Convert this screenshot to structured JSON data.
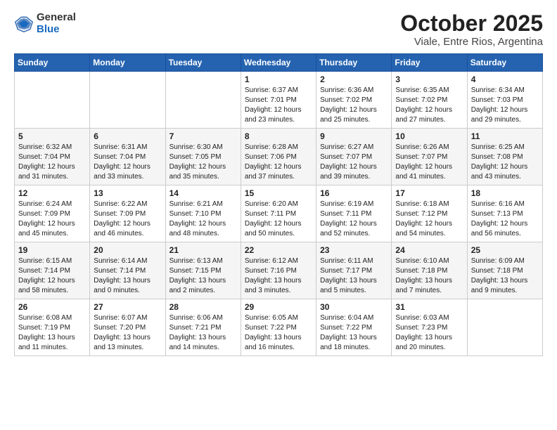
{
  "header": {
    "logo_general": "General",
    "logo_blue": "Blue",
    "title": "October 2025",
    "subtitle": "Viale, Entre Rios, Argentina"
  },
  "days_of_week": [
    "Sunday",
    "Monday",
    "Tuesday",
    "Wednesday",
    "Thursday",
    "Friday",
    "Saturday"
  ],
  "weeks": [
    [
      {
        "day": "",
        "info": ""
      },
      {
        "day": "",
        "info": ""
      },
      {
        "day": "",
        "info": ""
      },
      {
        "day": "1",
        "info": "Sunrise: 6:37 AM\nSunset: 7:01 PM\nDaylight: 12 hours\nand 23 minutes."
      },
      {
        "day": "2",
        "info": "Sunrise: 6:36 AM\nSunset: 7:02 PM\nDaylight: 12 hours\nand 25 minutes."
      },
      {
        "day": "3",
        "info": "Sunrise: 6:35 AM\nSunset: 7:02 PM\nDaylight: 12 hours\nand 27 minutes."
      },
      {
        "day": "4",
        "info": "Sunrise: 6:34 AM\nSunset: 7:03 PM\nDaylight: 12 hours\nand 29 minutes."
      }
    ],
    [
      {
        "day": "5",
        "info": "Sunrise: 6:32 AM\nSunset: 7:04 PM\nDaylight: 12 hours\nand 31 minutes."
      },
      {
        "day": "6",
        "info": "Sunrise: 6:31 AM\nSunset: 7:04 PM\nDaylight: 12 hours\nand 33 minutes."
      },
      {
        "day": "7",
        "info": "Sunrise: 6:30 AM\nSunset: 7:05 PM\nDaylight: 12 hours\nand 35 minutes."
      },
      {
        "day": "8",
        "info": "Sunrise: 6:28 AM\nSunset: 7:06 PM\nDaylight: 12 hours\nand 37 minutes."
      },
      {
        "day": "9",
        "info": "Sunrise: 6:27 AM\nSunset: 7:07 PM\nDaylight: 12 hours\nand 39 minutes."
      },
      {
        "day": "10",
        "info": "Sunrise: 6:26 AM\nSunset: 7:07 PM\nDaylight: 12 hours\nand 41 minutes."
      },
      {
        "day": "11",
        "info": "Sunrise: 6:25 AM\nSunset: 7:08 PM\nDaylight: 12 hours\nand 43 minutes."
      }
    ],
    [
      {
        "day": "12",
        "info": "Sunrise: 6:24 AM\nSunset: 7:09 PM\nDaylight: 12 hours\nand 45 minutes."
      },
      {
        "day": "13",
        "info": "Sunrise: 6:22 AM\nSunset: 7:09 PM\nDaylight: 12 hours\nand 46 minutes."
      },
      {
        "day": "14",
        "info": "Sunrise: 6:21 AM\nSunset: 7:10 PM\nDaylight: 12 hours\nand 48 minutes."
      },
      {
        "day": "15",
        "info": "Sunrise: 6:20 AM\nSunset: 7:11 PM\nDaylight: 12 hours\nand 50 minutes."
      },
      {
        "day": "16",
        "info": "Sunrise: 6:19 AM\nSunset: 7:11 PM\nDaylight: 12 hours\nand 52 minutes."
      },
      {
        "day": "17",
        "info": "Sunrise: 6:18 AM\nSunset: 7:12 PM\nDaylight: 12 hours\nand 54 minutes."
      },
      {
        "day": "18",
        "info": "Sunrise: 6:16 AM\nSunset: 7:13 PM\nDaylight: 12 hours\nand 56 minutes."
      }
    ],
    [
      {
        "day": "19",
        "info": "Sunrise: 6:15 AM\nSunset: 7:14 PM\nDaylight: 12 hours\nand 58 minutes."
      },
      {
        "day": "20",
        "info": "Sunrise: 6:14 AM\nSunset: 7:14 PM\nDaylight: 13 hours\nand 0 minutes."
      },
      {
        "day": "21",
        "info": "Sunrise: 6:13 AM\nSunset: 7:15 PM\nDaylight: 13 hours\nand 2 minutes."
      },
      {
        "day": "22",
        "info": "Sunrise: 6:12 AM\nSunset: 7:16 PM\nDaylight: 13 hours\nand 3 minutes."
      },
      {
        "day": "23",
        "info": "Sunrise: 6:11 AM\nSunset: 7:17 PM\nDaylight: 13 hours\nand 5 minutes."
      },
      {
        "day": "24",
        "info": "Sunrise: 6:10 AM\nSunset: 7:18 PM\nDaylight: 13 hours\nand 7 minutes."
      },
      {
        "day": "25",
        "info": "Sunrise: 6:09 AM\nSunset: 7:18 PM\nDaylight: 13 hours\nand 9 minutes."
      }
    ],
    [
      {
        "day": "26",
        "info": "Sunrise: 6:08 AM\nSunset: 7:19 PM\nDaylight: 13 hours\nand 11 minutes."
      },
      {
        "day": "27",
        "info": "Sunrise: 6:07 AM\nSunset: 7:20 PM\nDaylight: 13 hours\nand 13 minutes."
      },
      {
        "day": "28",
        "info": "Sunrise: 6:06 AM\nSunset: 7:21 PM\nDaylight: 13 hours\nand 14 minutes."
      },
      {
        "day": "29",
        "info": "Sunrise: 6:05 AM\nSunset: 7:22 PM\nDaylight: 13 hours\nand 16 minutes."
      },
      {
        "day": "30",
        "info": "Sunrise: 6:04 AM\nSunset: 7:22 PM\nDaylight: 13 hours\nand 18 minutes."
      },
      {
        "day": "31",
        "info": "Sunrise: 6:03 AM\nSunset: 7:23 PM\nDaylight: 13 hours\nand 20 minutes."
      },
      {
        "day": "",
        "info": ""
      }
    ]
  ]
}
